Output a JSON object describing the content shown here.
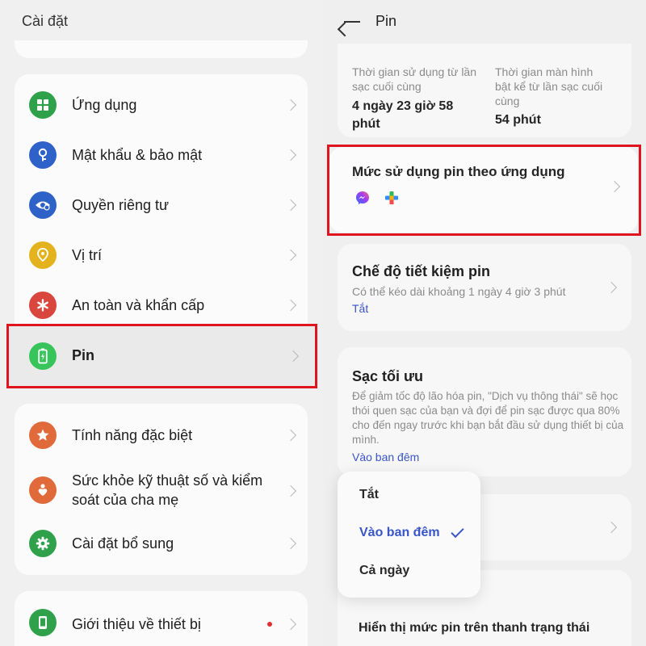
{
  "left": {
    "title": "Cài đặt",
    "items": [
      {
        "label": "Ứng dụng",
        "icon": "apps-icon",
        "color": "#2fa14a"
      },
      {
        "label": "Mật khẩu & bảo mật",
        "icon": "key-icon",
        "color": "#2f62c9"
      },
      {
        "label": "Quyền riêng tư",
        "icon": "privacy-eye-icon",
        "color": "#2f62c9"
      },
      {
        "label": "Vị trí",
        "icon": "location-icon",
        "color": "#e3b21c"
      },
      {
        "label": "An toàn và khẩn cấp",
        "icon": "emergency-icon",
        "color": "#d8463e"
      },
      {
        "label": "Pin",
        "icon": "battery-icon",
        "color": "#37c45a"
      },
      {
        "label": "Tính năng đặc biệt",
        "icon": "star-icon",
        "color": "#e06a3a"
      },
      {
        "label": "Sức khỏe kỹ thuật số và kiểm soát của cha mẹ",
        "label_line1": "Sức khỏe kỹ thuật số và kiểm",
        "label_line2": "soát của cha mẹ",
        "icon": "wellbeing-icon",
        "color": "#e06a3a"
      },
      {
        "label": "Cài đặt bổ sung",
        "icon": "gear-icon",
        "color": "#2fa14a"
      },
      {
        "label": "Giới thiệu về thiết bị",
        "icon": "phone-icon",
        "color": "#2fa14a"
      }
    ]
  },
  "right": {
    "title": "Pin",
    "usage_label": "Thời gian sử dụng từ lần sạc cuối cùng",
    "usage_label_l1": "Thời gian sử dụng từ lần",
    "usage_label_l2": "sạc cuối cùng",
    "usage_value_l1": "4 ngày 23 giờ 58",
    "usage_value_l2": "phút",
    "screen_label_l1": "Thời gian màn hình",
    "screen_label_l2": "bật kể từ lần sạc cuối",
    "screen_label_l3": "cùng",
    "screen_value": "54 phút",
    "app_usage_title": "Mức sử dụng pin theo ứng dụng",
    "saver_title": "Chế độ tiết kiệm pin",
    "saver_desc": "Có thể kéo dài khoảng 1 ngày 4 giờ 3 phút",
    "saver_state": "Tắt",
    "opt_title": "Sạc tối ưu",
    "opt_desc_l1": "Để giảm tốc độ lão hóa pin, \"Dịch vụ thông thái\" sẽ học",
    "opt_desc_l2": "thói quen sạc của bạn và đợi để pin sạc được qua 80%",
    "opt_desc_l3": "cho đến ngay trước khi bạn bắt đầu sử dụng thiết bị của",
    "opt_desc_l4": "mình.",
    "opt_value": "Vào ban đêm",
    "bottom_item": "Hiển thị mức pin trên thanh trạng thái"
  },
  "popup": {
    "options": [
      "Tắt",
      "Vào ban đêm",
      "Cả ngày"
    ],
    "selected": "Vào ban đêm"
  },
  "colors": {
    "highlight": "#e0141e",
    "accent": "#3a55c9"
  }
}
